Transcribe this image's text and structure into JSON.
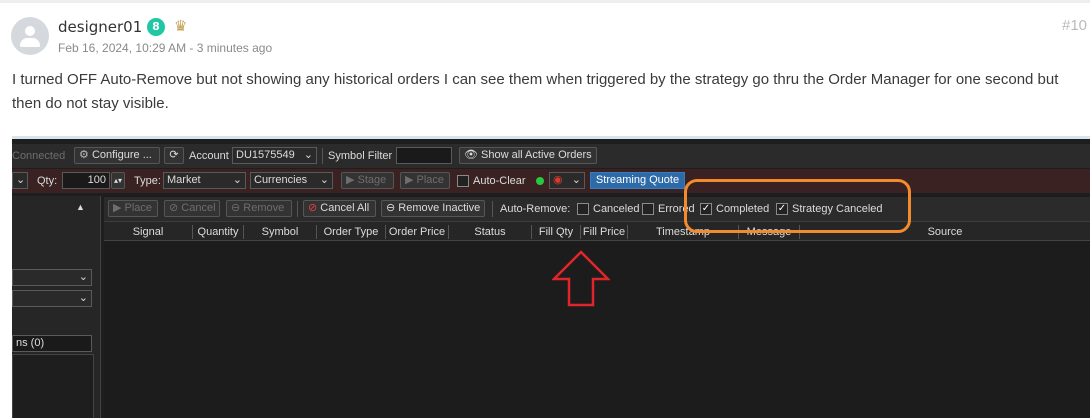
{
  "post": {
    "username": "designer01",
    "badge_count": "8",
    "crown_icon": "crown-icon",
    "meta": "Feb 16, 2024, 10:29 AM - 3 minutes ago",
    "post_number": "#10",
    "text": "I turned OFF Auto-Remove but not showing any historical orders I can see them when triggered by the strategy go thru the Order Manager for one second but then do not stay visible."
  },
  "app": {
    "toolbar1": {
      "connected": "Connected",
      "configure": "Configure ...",
      "account_label": "Account",
      "account_value": "DU1575549",
      "symbol_filter": "Symbol Filter",
      "show_all": "Show all Active Orders"
    },
    "toolbar2": {
      "qty_label": "Qty:",
      "qty_value": "100",
      "type_label": "Type:",
      "type_value": "Market",
      "currencies": "Currencies",
      "stage": "Stage",
      "place": "Place",
      "auto_clear": "Auto-Clear",
      "streaming": "Streaming Quote"
    },
    "toolbar3": {
      "place": "Place",
      "cancel": "Cancel",
      "remove": "Remove",
      "cancel_all": "Cancel All",
      "remove_inactive": "Remove Inactive",
      "auto_remove": "Auto-Remove:",
      "canceled": "Canceled",
      "errored": "Errored",
      "completed": "Completed",
      "strategy_canceled": "Strategy Canceled"
    },
    "columns": [
      "Signal",
      "Quantity",
      "Symbol",
      "Order Type",
      "Order Price",
      "Status",
      "Fill Qty",
      "Fill Price",
      "Timestamp",
      "Message",
      "Source"
    ],
    "left_panel": {
      "item": "ns (0)"
    }
  },
  "colors": {
    "accent_badge": "#1fc7a5",
    "highlight_box": "#f28a2e",
    "arrow": "#e0262b",
    "streaming_button": "#2d6aa8"
  }
}
